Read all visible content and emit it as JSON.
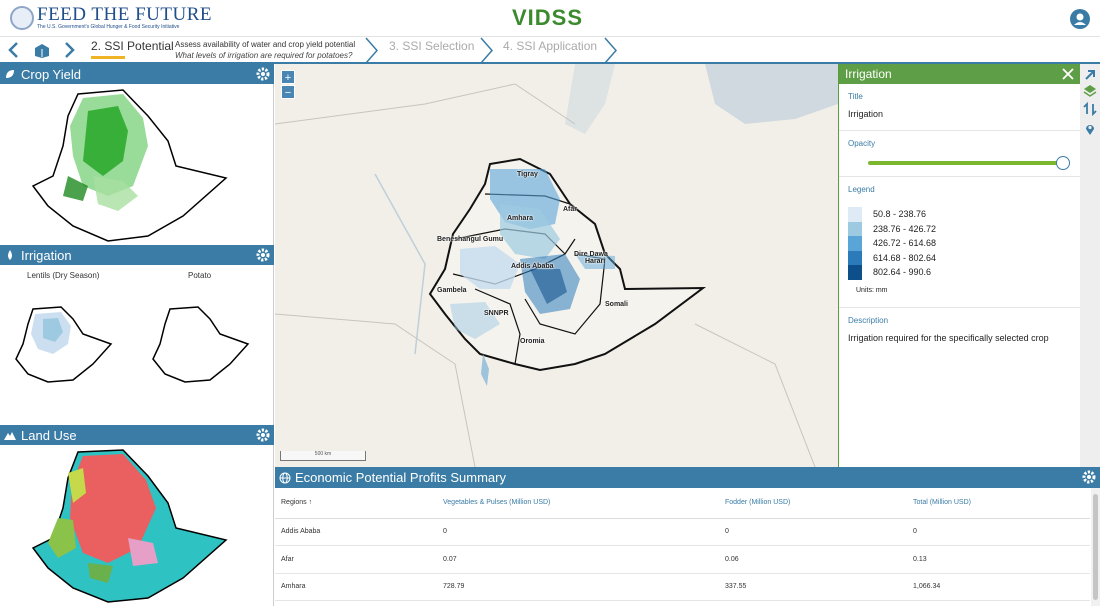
{
  "header": {
    "brand_name": "FEED THE FUTURE",
    "brand_tagline": "The U.S. Government's Global Hunger & Food Security Initiative",
    "app_logo": "VIDSS",
    "user_icon": "user-circle-icon"
  },
  "stepper": {
    "active_step": "2. SSI Potential",
    "active_desc": "Assess availability of water and crop yield potential",
    "active_question": "What levels of irrigation are required for potatoes?",
    "step3": "3. SSI Selection",
    "step4": "4. SSI Application"
  },
  "panels": {
    "crop_yield": {
      "title": "Crop Yield"
    },
    "irrigation": {
      "title": "Irrigation",
      "map1_label": "Lentils (Dry Season)",
      "map2_label": "Potato"
    },
    "land_use": {
      "title": "Land Use"
    }
  },
  "main_map": {
    "zoom_in": "+",
    "zoom_out": "−",
    "scale_label": "500 km",
    "regions": [
      "Tigray",
      "Afar",
      "Amhara",
      "Beneshangul Gumu",
      "Addis Ababa",
      "Dire Dawa",
      "Harari",
      "Gambela",
      "SNNPR",
      "Oromia",
      "Somali"
    ]
  },
  "info_panel": {
    "title": "Irrigation",
    "title_label": "Title",
    "title_value": "Irrigation",
    "opacity_label": "Opacity",
    "opacity": 1.0,
    "legend_label": "Legend",
    "legend": [
      {
        "range": "50.8 - 238.76",
        "color": "#deebf7"
      },
      {
        "range": "238.76 - 426.72",
        "color": "#9ecae1"
      },
      {
        "range": "426.72 - 614.68",
        "color": "#5aa5d8"
      },
      {
        "range": "614.68 - 802.64",
        "color": "#2b7bba"
      },
      {
        "range": "802.64 - 990.6",
        "color": "#0d4f8b"
      }
    ],
    "units": "Units: mm",
    "description_label": "Description",
    "description": "Irrigation required for the specifically selected crop"
  },
  "economic": {
    "title": "Economic Potential Profits Summary",
    "columns": [
      "Regions",
      "Vegetables & Pulses (Million USD)",
      "Fodder (Million USD)",
      "Total (Million USD)"
    ],
    "sort_indicator": "↑",
    "rows": [
      [
        "Addis Ababa",
        "0",
        "0",
        "0"
      ],
      [
        "Afar",
        "0.07",
        "0.06",
        "0.13"
      ],
      [
        "Amhara",
        "728.79",
        "337.55",
        "1,066.34"
      ]
    ]
  }
}
